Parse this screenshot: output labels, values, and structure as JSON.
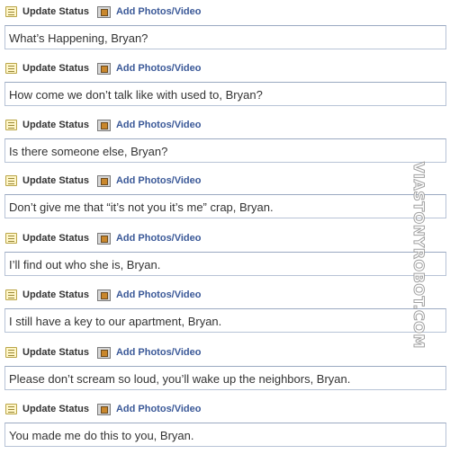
{
  "tabs": {
    "update_status": "Update Status",
    "add_photos_video": "Add Photos/Video"
  },
  "icons": {
    "update_status": "status-note-icon",
    "add_photos_video": "photo-frame-icon"
  },
  "colors": {
    "link_blue": "#3b5998",
    "field_border": "#b7c3d6",
    "text": "#333333"
  },
  "posts": [
    {
      "text": "What’s Happening, Bryan?"
    },
    {
      "text": "How come we don’t talk like with used to, Bryan?"
    },
    {
      "text": "Is there someone else, Bryan?"
    },
    {
      "text": "Don’t give me that “it’s not you it’s me” crap, Bryan."
    },
    {
      "text": "I’ll find out who she is, Bryan."
    },
    {
      "text": "I still have a key to our apartment, Bryan."
    },
    {
      "text": "Please don’t scream so loud, you’ll wake up the neighbors, Bryan."
    },
    {
      "text": "You made me do this to you, Bryan."
    }
  ],
  "watermark": "VIASTONYROBOT.COM"
}
